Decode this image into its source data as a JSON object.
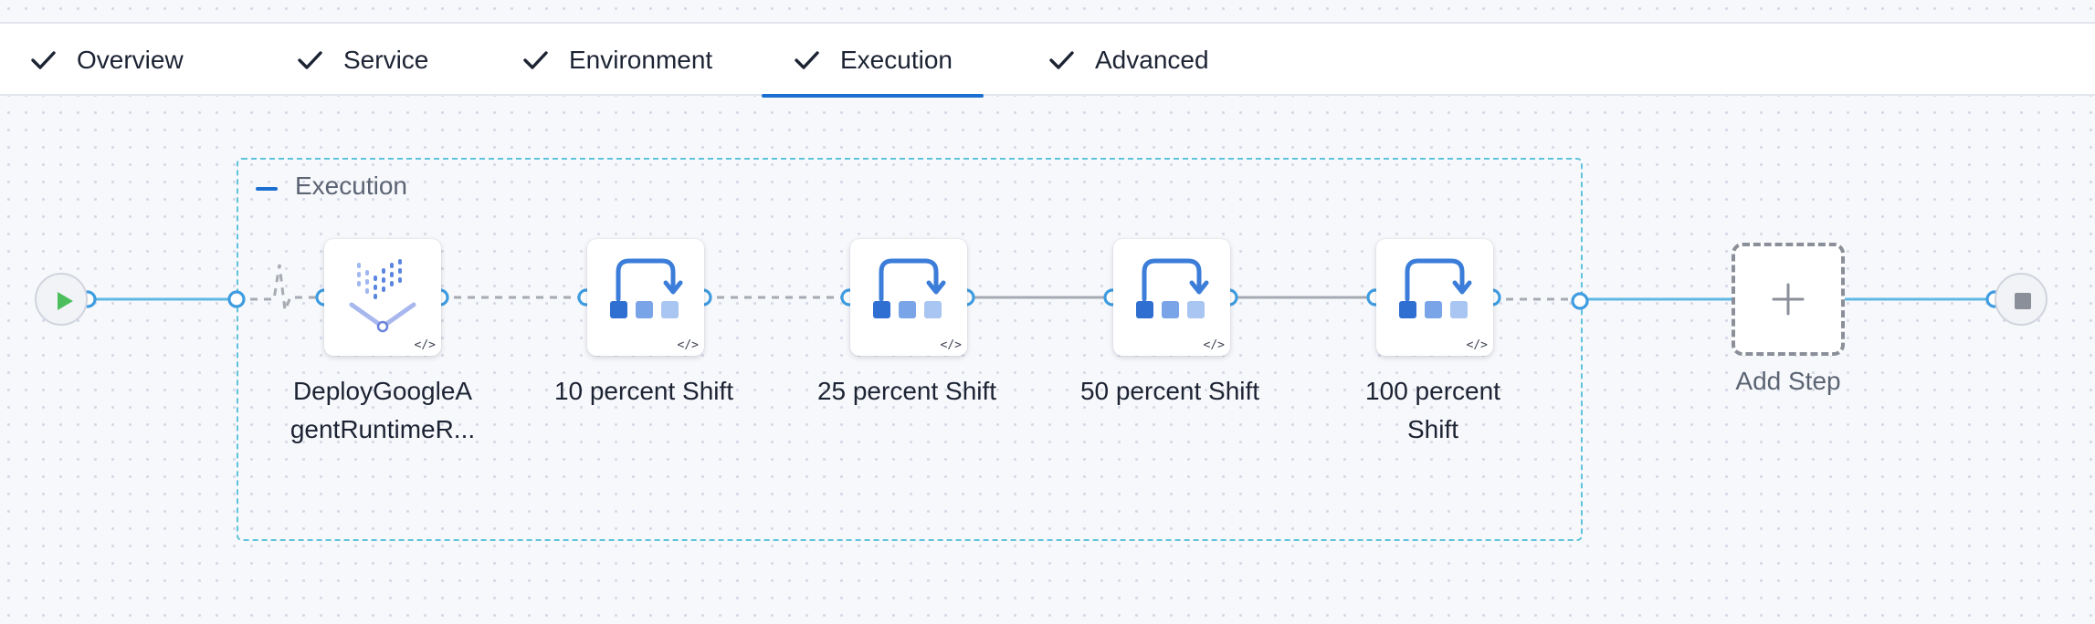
{
  "tabs": [
    {
      "label": "Overview",
      "completed": true,
      "active": false
    },
    {
      "label": "Service",
      "completed": true,
      "active": false
    },
    {
      "label": "Environment",
      "completed": true,
      "active": false
    },
    {
      "label": "Execution",
      "completed": true,
      "active": true
    },
    {
      "label": "Advanced",
      "completed": true,
      "active": false
    }
  ],
  "stage": {
    "title": "Execution"
  },
  "steps": [
    {
      "label_line1": "DeployGoogleA",
      "label_line2": "gentRuntimeR...",
      "icon": "google-agent-runtime-icon",
      "badge": "</>"
    },
    {
      "label_line1": "10 percent Shift",
      "label_line2": "",
      "icon": "traffic-shift-icon",
      "badge": "</>"
    },
    {
      "label_line1": "25 percent Shift",
      "label_line2": "",
      "icon": "traffic-shift-icon",
      "badge": "</>"
    },
    {
      "label_line1": "50 percent Shift",
      "label_line2": "",
      "icon": "traffic-shift-icon",
      "badge": "</>"
    },
    {
      "label_line1": "100 percent",
      "label_line2": "Shift",
      "icon": "traffic-shift-icon",
      "badge": "</>"
    }
  ],
  "add_step": {
    "label": "Add Step"
  },
  "colors": {
    "accent": "#1b6fd1",
    "wire": "#5fb8e4",
    "step_icon": "#3b7dd8",
    "stage_border": "#5fc3dc"
  }
}
